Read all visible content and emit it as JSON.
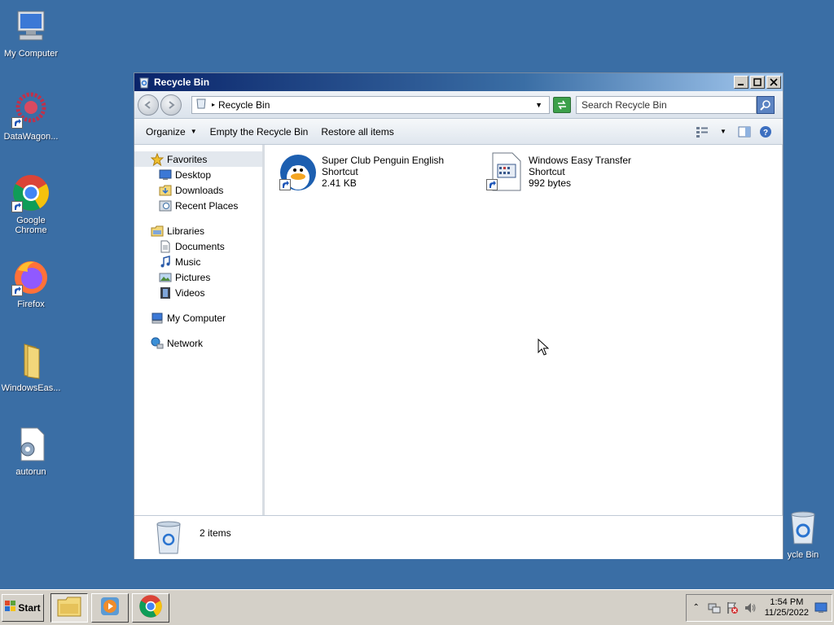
{
  "desktop": {
    "icons": [
      {
        "label": "My Computer",
        "icon": "my-computer-icon"
      },
      {
        "label": "DataWagon...",
        "icon": "datawagon-icon"
      },
      {
        "label": "Google Chrome",
        "icon": "chrome-icon"
      },
      {
        "label": "Firefox",
        "icon": "firefox-icon"
      },
      {
        "label": "WindowsEas...",
        "icon": "folder-icon"
      },
      {
        "label": "autorun",
        "icon": "settings-file-icon"
      },
      {
        "label": "ycle Bin",
        "icon": "recycle-bin-icon"
      }
    ]
  },
  "window": {
    "title": "Recycle Bin",
    "address": "Recycle Bin",
    "search_placeholder": "Search Recycle Bin",
    "commands": {
      "organize": "Organize",
      "empty": "Empty the Recycle Bin",
      "restore": "Restore all items"
    },
    "nav": {
      "favorites": {
        "label": "Favorites",
        "items": [
          "Desktop",
          "Downloads",
          "Recent Places"
        ]
      },
      "libraries": {
        "label": "Libraries",
        "items": [
          "Documents",
          "Music",
          "Pictures",
          "Videos"
        ]
      },
      "computer": "My Computer",
      "network": "Network"
    },
    "files": [
      {
        "name": "Super Club Penguin English",
        "type": "Shortcut",
        "size": "2.41 KB",
        "icon": "penguin-icon"
      },
      {
        "name": "Windows Easy Transfer",
        "type": "Shortcut",
        "size": "992 bytes",
        "icon": "document-icon"
      }
    ],
    "status": "2 items"
  },
  "taskbar": {
    "start_label": "Start",
    "time": "1:54 PM",
    "date": "11/25/2022"
  },
  "colors": {
    "desktop": "#3a6ea5",
    "titlebar": "#0a246a",
    "taskbar": "#d4d0c8"
  }
}
